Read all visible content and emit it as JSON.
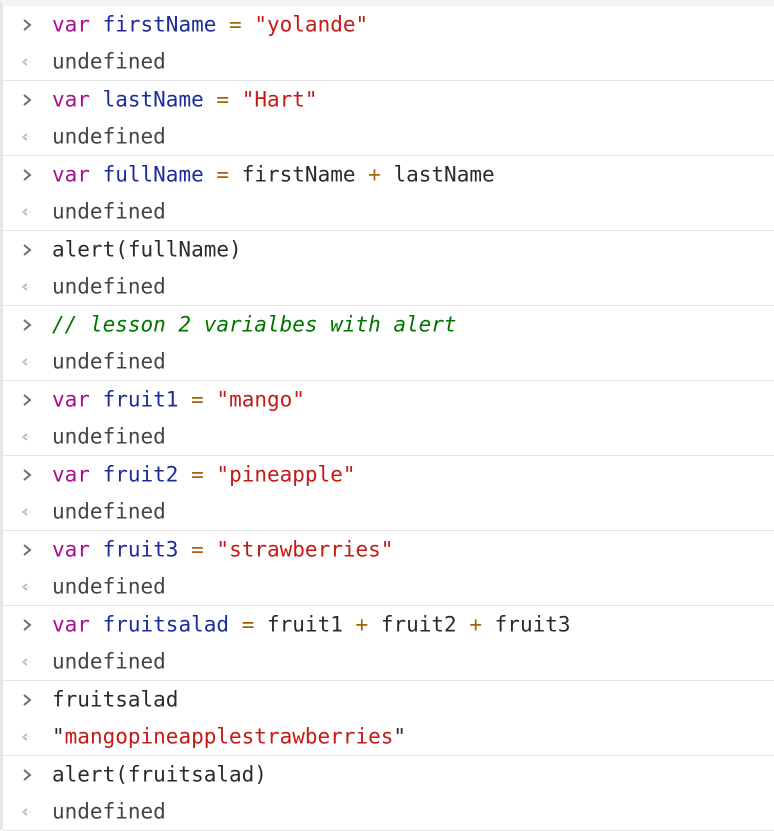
{
  "console": {
    "entries": [
      {
        "input": {
          "keyword": "var",
          "name": "firstName",
          "op": "=",
          "value": "\"yolande\""
        },
        "output": "undefined"
      },
      {
        "input": {
          "keyword": "var",
          "name": "lastName",
          "op": "=",
          "value": "\"Hart\""
        },
        "output": "undefined"
      },
      {
        "input": {
          "keyword": "var",
          "name": "fullName",
          "op": "=",
          "a": "firstName",
          "plus": "+",
          "b": "lastName"
        },
        "output": "undefined"
      },
      {
        "input": {
          "text": "alert(fullName)"
        },
        "output": "undefined"
      },
      {
        "input": {
          "comment": "// lesson 2 varialbes with alert"
        },
        "output": "undefined"
      },
      {
        "input": {
          "keyword": "var",
          "name": "fruit1",
          "op": "=",
          "value": "\"mango\""
        },
        "output": "undefined"
      },
      {
        "input": {
          "keyword": "var",
          "name": "fruit2",
          "op": "=",
          "value": "\"pineapple\""
        },
        "output": "undefined"
      },
      {
        "input": {
          "keyword": "var",
          "name": "fruit3",
          "op": "=",
          "value": "\"strawberries\""
        },
        "output": "undefined"
      },
      {
        "input": {
          "keyword": "var",
          "name": "fruitsalad",
          "op": "=",
          "a": "fruit1",
          "plus1": "+",
          "b": "fruit2",
          "plus2": "+",
          "c": "fruit3"
        },
        "output": "undefined"
      },
      {
        "input": {
          "text": "fruitsalad"
        },
        "output_quote_open": "\"",
        "output_string": "mangopineapplestrawberries",
        "output_quote_close": "\""
      },
      {
        "input": {
          "text": "alert(fruitsalad)"
        },
        "output": "undefined"
      }
    ]
  },
  "icons": {
    "input_prompt": "chevron-right-icon",
    "output_prompt": "return-arrow-icon"
  },
  "colors": {
    "keyword": "#aa0d91",
    "variable": "#1c00cf",
    "operator": "#a4630c",
    "string": "#c41a16",
    "comment": "#007400"
  }
}
